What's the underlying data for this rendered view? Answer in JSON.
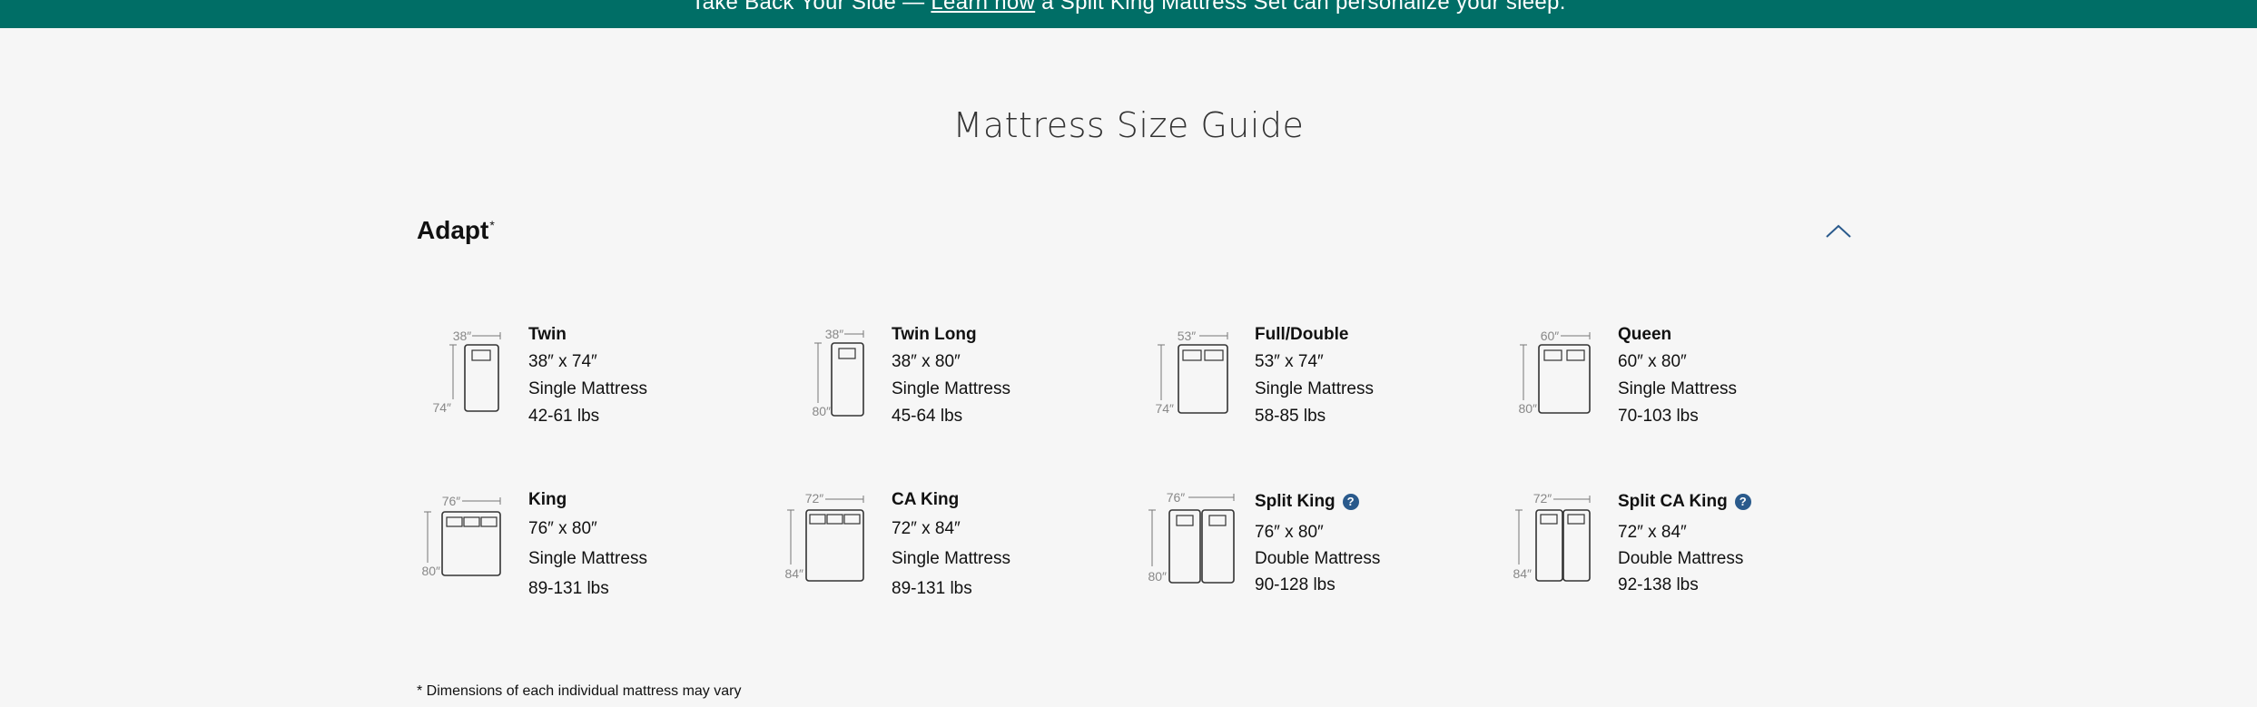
{
  "promo": {
    "before": "Take Back Your Side — ",
    "link": "Learn now",
    "after": " a Split King Mattress Set can personalize your sleep."
  },
  "page_title": "Mattress Size Guide",
  "section": {
    "title": "Adapt",
    "asterisk": "*",
    "toggle_icon": "chevron-up-icon"
  },
  "sizes": [
    {
      "name": "Twin",
      "dimensions": "38″ x 74″",
      "type": "Single Mattress",
      "weight": "42-61 lbs",
      "width_label": "38″",
      "length_label": "74″",
      "has_help": false
    },
    {
      "name": "Twin Long",
      "dimensions": "38″ x 80″",
      "type": "Single Mattress",
      "weight": "45-64 lbs",
      "width_label": "38″",
      "length_label": "80″",
      "has_help": false
    },
    {
      "name": "Full/Double",
      "dimensions": "53″ x 74″",
      "type": "Single Mattress",
      "weight": "58-85 lbs",
      "width_label": "53″",
      "length_label": "74″",
      "has_help": false
    },
    {
      "name": "Queen",
      "dimensions": "60″ x 80″",
      "type": "Single Mattress",
      "weight": "70-103 lbs",
      "width_label": "60″",
      "length_label": "80″",
      "has_help": false
    },
    {
      "name": "King",
      "dimensions": "76″ x 80″",
      "type": "Single Mattress",
      "weight": "89-131 lbs",
      "width_label": "76″",
      "length_label": "80″",
      "has_help": false
    },
    {
      "name": "CA King",
      "dimensions": "72″ x 84″",
      "type": "Single Mattress",
      "weight": "89-131 lbs",
      "width_label": "72″",
      "length_label": "84″",
      "has_help": false
    },
    {
      "name": "Split King",
      "dimensions": "76″ x 80″",
      "type": "Double Mattress",
      "weight": "90-128 lbs",
      "width_label": "76″",
      "length_label": "80″",
      "has_help": true,
      "help_label": "?"
    },
    {
      "name": "Split CA King",
      "dimensions": "72″ x 84″",
      "type": "Double Mattress",
      "weight": "92-138 lbs",
      "width_label": "72″",
      "length_label": "84″",
      "has_help": true,
      "help_label": "?"
    }
  ],
  "footnote": "* Dimensions of each individual mattress may vary",
  "colors": {
    "promo_bg": "#006e66",
    "accent": "#2a5a8c",
    "page_bg": "#f6f6f6"
  }
}
